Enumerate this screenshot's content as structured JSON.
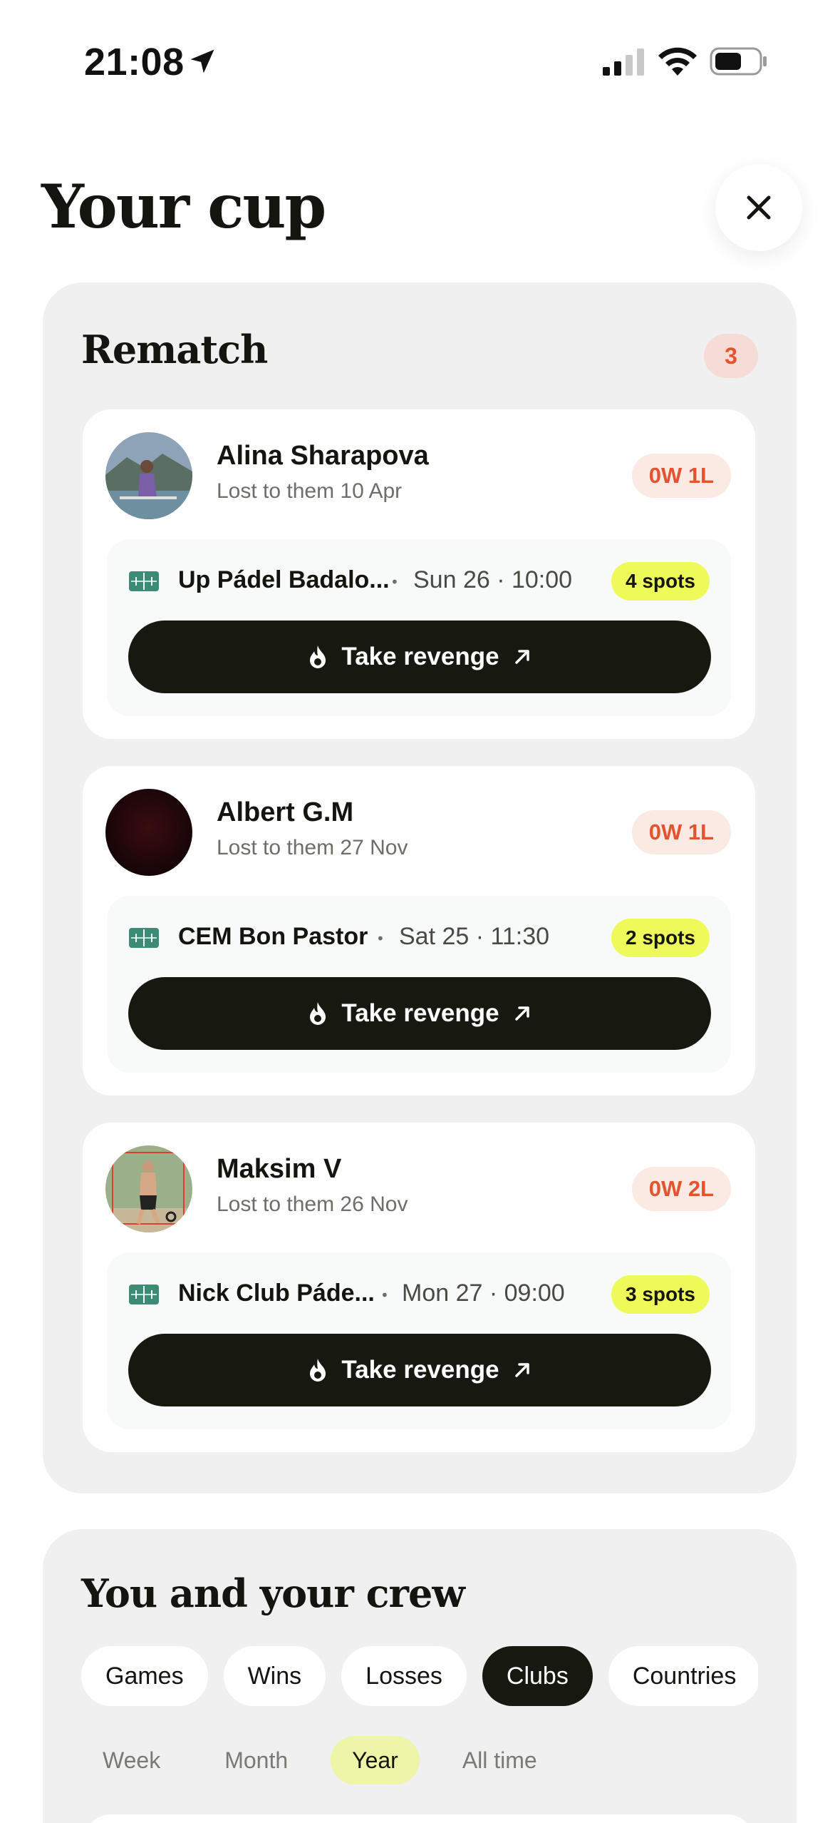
{
  "status_bar": {
    "time": "21:08",
    "icons": [
      "location-arrow-icon",
      "cellular-signal-icon",
      "wifi-icon",
      "battery-icon"
    ]
  },
  "header": {
    "title": "Your cup",
    "close_icon": "close-icon"
  },
  "rematch": {
    "title": "Rematch",
    "count": "3",
    "cards": [
      {
        "name": "Alina Sharapova",
        "subtitle": "Lost to them 10 Apr",
        "record": "0W 1L",
        "club": "Up Pádel Badalo...",
        "time": "Sun 26 · 10:00",
        "spots": "4 spots",
        "button": "Take revenge"
      },
      {
        "name": "Albert G.M",
        "subtitle": "Lost to them 27 Nov",
        "record": "0W 1L",
        "club": "CEM Bon Pastor",
        "time": "Sat 25 · 11:30",
        "spots": "2 spots",
        "button": "Take revenge"
      },
      {
        "name": "Maksim V",
        "subtitle": "Lost to them 26 Nov",
        "record": "0W 2L",
        "club": "Nick Club Páde...",
        "time": "Mon 27 · 09:00",
        "spots": "3 spots",
        "button": "Take revenge"
      }
    ]
  },
  "crew": {
    "title": "You and your crew",
    "filters": [
      "Games",
      "Wins",
      "Losses",
      "Clubs",
      "Countries"
    ],
    "active_filter": "Clubs",
    "periods": [
      "Week",
      "Month",
      "Year",
      "All time"
    ],
    "active_period": "Year"
  },
  "colors": {
    "accent_dark": "#17180f",
    "loss_red": "#e4532f",
    "spots_yellow": "#eef95a",
    "panel_bg": "#f0f0f0"
  }
}
